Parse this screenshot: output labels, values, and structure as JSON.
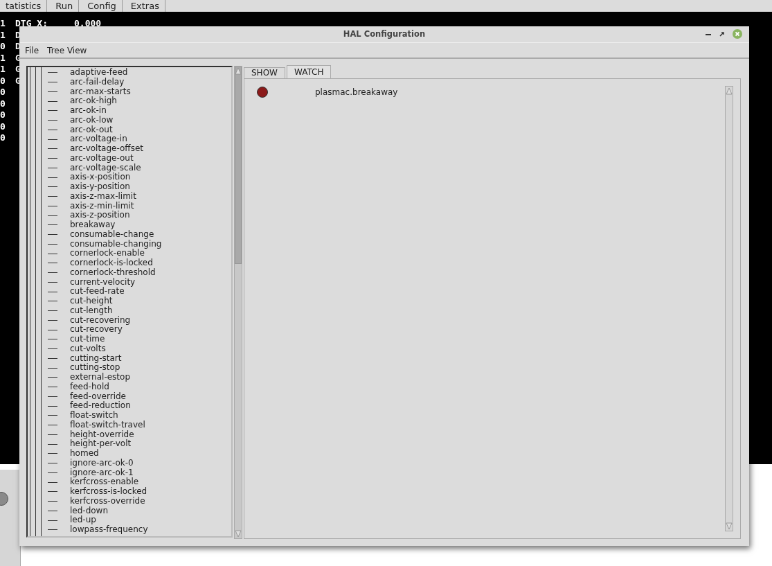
{
  "background_app": {
    "tabs": [
      "tatistics",
      "Run",
      "Config",
      "Extras"
    ],
    "status_rows": [
      {
        "value": "1",
        "label": "DTG X:",
        "reading": "0.000"
      },
      {
        "value": "1",
        "label": "D"
      },
      {
        "value": "0",
        "label": "D"
      },
      {
        "value": "1",
        "label": "G"
      },
      {
        "value": "1",
        "label": "G"
      },
      {
        "value": "0",
        "label": "G"
      },
      {
        "value": "0"
      },
      {
        "value": "0"
      },
      {
        "value": "0"
      },
      {
        "value": "0"
      },
      {
        "value": "0"
      }
    ]
  },
  "window": {
    "title": "HAL Configuration"
  },
  "menu": [
    "File",
    "Tree View"
  ],
  "tree_items": [
    "adaptive-feed",
    "arc-fail-delay",
    "arc-max-starts",
    "arc-ok-high",
    "arc-ok-in",
    "arc-ok-low",
    "arc-ok-out",
    "arc-voltage-in",
    "arc-voltage-offset",
    "arc-voltage-out",
    "arc-voltage-scale",
    "axis-x-position",
    "axis-y-position",
    "axis-z-max-limit",
    "axis-z-min-limit",
    "axis-z-position",
    "breakaway",
    "consumable-change",
    "consumable-changing",
    "cornerlock-enable",
    "cornerlock-is-locked",
    "cornerlock-threshold",
    "current-velocity",
    "cut-feed-rate",
    "cut-height",
    "cut-length",
    "cut-recovering",
    "cut-recovery",
    "cut-time",
    "cut-volts",
    "cutting-start",
    "cutting-stop",
    "external-estop",
    "feed-hold",
    "feed-override",
    "feed-reduction",
    "float-switch",
    "float-switch-travel",
    "height-override",
    "height-per-volt",
    "homed",
    "ignore-arc-ok-0",
    "ignore-arc-ok-1",
    "kerfcross-enable",
    "kerfcross-is-locked",
    "kerfcross-override",
    "led-down",
    "led-up",
    "lowpass-frequency"
  ],
  "tabs": [
    {
      "label": "SHOW",
      "selected": false
    },
    {
      "label": "WATCH",
      "selected": true
    }
  ],
  "watch": [
    {
      "name": "plasmac.breakaway",
      "on": false
    }
  ]
}
